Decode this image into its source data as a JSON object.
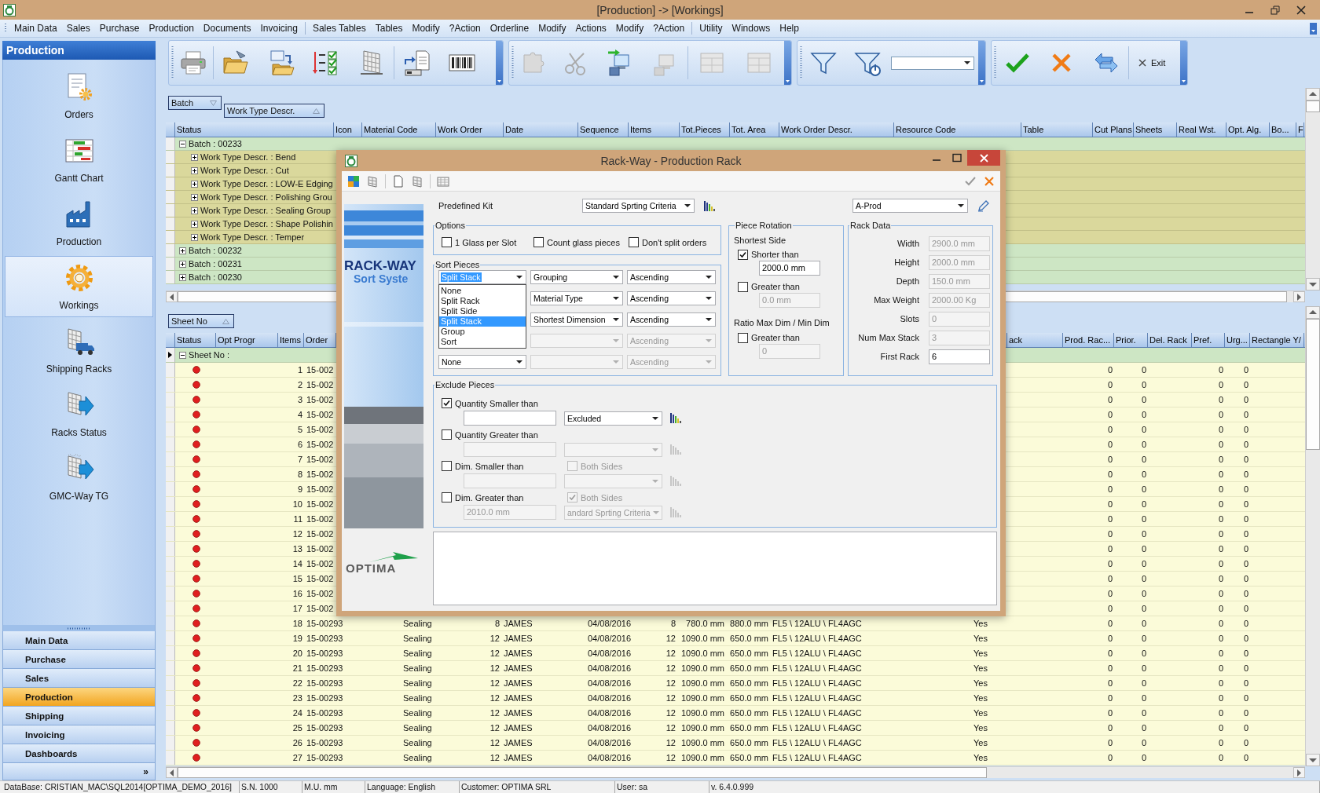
{
  "window": {
    "title": "[Production] -> [Workings]"
  },
  "menu": [
    [
      "Main Data",
      "Sales",
      "Purchase",
      "Production",
      "Documents",
      "Invoicing"
    ],
    [
      "Sales Tables",
      "Tables",
      "Modify",
      "?Action",
      "Orderline",
      "Modify",
      "Actions",
      "Modify",
      "?Action"
    ],
    [
      "Utility",
      "Windows",
      "Help"
    ]
  ],
  "sidebar": {
    "title": "Production",
    "items": [
      {
        "label": "Orders",
        "selected": false
      },
      {
        "label": "Gantt Chart",
        "selected": false
      },
      {
        "label": "Production",
        "selected": false
      },
      {
        "label": "Workings",
        "selected": true
      },
      {
        "label": "Shipping Racks",
        "selected": false
      },
      {
        "label": "Racks Status",
        "selected": false
      },
      {
        "label": "GMC-Way TG",
        "selected": false
      }
    ],
    "nav": [
      {
        "label": "Main Data",
        "selected": false
      },
      {
        "label": "Purchase",
        "selected": false
      },
      {
        "label": "Sales",
        "selected": false
      },
      {
        "label": "Production",
        "selected": true
      },
      {
        "label": "Shipping",
        "selected": false
      },
      {
        "label": "Invoicing",
        "selected": false
      },
      {
        "label": "Dashboards",
        "selected": false
      }
    ],
    "more": "»"
  },
  "toolbar": {
    "exit": "Exit"
  },
  "batch_grid": {
    "group_by": [
      {
        "label": "Batch",
        "descending": true
      },
      {
        "label": "Work Type Descr.",
        "descending": false
      }
    ],
    "columns": [
      "Status",
      "Icon",
      "Material Code",
      "Work Order",
      "Date",
      "Sequence",
      "Items",
      "Tot.Pieces",
      "Tot. Area",
      "Work Order Descr.",
      "Resource Code",
      "Table",
      "Cut Plans",
      "Sheets",
      "Real Wst.",
      "Opt. Alg.",
      "Bo...",
      "F"
    ],
    "rows": [
      {
        "label": "Batch : 00233",
        "expanded": true,
        "children": [
          {
            "label": "Work Type Descr. : Bend",
            "expanded": false
          },
          {
            "label": "Work Type Descr. : Cut",
            "expanded": false
          },
          {
            "label": "Work Type Descr. : LOW-E Edging",
            "expanded": false
          },
          {
            "label": "Work Type Descr. : Polishing Grou",
            "expanded": false
          },
          {
            "label": "Work Type Descr. : Sealing Group",
            "expanded": false
          },
          {
            "label": "Work Type Descr. : Shape Polishin",
            "expanded": false
          },
          {
            "label": "Work Type Descr. : Temper",
            "expanded": false
          }
        ]
      },
      {
        "label": "Batch : 00232",
        "expanded": false
      },
      {
        "label": "Batch : 00231",
        "expanded": false
      },
      {
        "label": "Batch : 00230",
        "expanded": false
      }
    ]
  },
  "sheet_grid": {
    "group_by": [
      {
        "label": "Sheet No",
        "descending": false
      }
    ],
    "columns_left": [
      "Status",
      "Opt Progr",
      "Items",
      "Order"
    ],
    "columns_right": [
      "ack",
      "Prod. Rac...",
      "Prior.",
      "Del. Rack",
      "Pref.",
      "Urg...",
      "Rectangle Y/"
    ],
    "group_row": {
      "label": "Sheet No :",
      "expanded": true,
      "current": true
    },
    "rows": [
      {
        "items": "1",
        "order": "15-002",
        "prod_rac": "0",
        "prior": "0",
        "pref": "0",
        "urg": "0"
      },
      {
        "items": "2",
        "order": "15-002",
        "prod_rac": "0",
        "prior": "0",
        "pref": "0",
        "urg": "0"
      },
      {
        "items": "3",
        "order": "15-002",
        "prod_rac": "0",
        "prior": "0",
        "pref": "0",
        "urg": "0"
      },
      {
        "items": "4",
        "order": "15-002",
        "prod_rac": "0",
        "prior": "0",
        "pref": "0",
        "urg": "0"
      },
      {
        "items": "5",
        "order": "15-002",
        "prod_rac": "0",
        "prior": "0",
        "pref": "0",
        "urg": "0"
      },
      {
        "items": "6",
        "order": "15-002",
        "prod_rac": "0",
        "prior": "0",
        "pref": "0",
        "urg": "0"
      },
      {
        "items": "7",
        "order": "15-002",
        "prod_rac": "0",
        "prior": "0",
        "pref": "0",
        "urg": "0"
      },
      {
        "items": "8",
        "order": "15-002",
        "prod_rac": "0",
        "prior": "0",
        "pref": "0",
        "urg": "0"
      },
      {
        "items": "9",
        "order": "15-002",
        "prod_rac": "0",
        "prior": "0",
        "pref": "0",
        "urg": "0"
      },
      {
        "items": "10",
        "order": "15-002",
        "prod_rac": "0",
        "prior": "0",
        "pref": "0",
        "urg": "0"
      },
      {
        "items": "11",
        "order": "15-002",
        "prod_rac": "0",
        "prior": "0",
        "pref": "0",
        "urg": "0"
      },
      {
        "items": "12",
        "order": "15-002",
        "prod_rac": "0",
        "prior": "0",
        "pref": "0",
        "urg": "0"
      },
      {
        "items": "13",
        "order": "15-002",
        "prod_rac": "0",
        "prior": "0",
        "pref": "0",
        "urg": "0"
      },
      {
        "items": "14",
        "order": "15-002",
        "prod_rac": "0",
        "prior": "0",
        "pref": "0",
        "urg": "0"
      },
      {
        "items": "15",
        "order": "15-002",
        "prod_rac": "0",
        "prior": "0",
        "pref": "0",
        "urg": "0"
      },
      {
        "items": "16",
        "order": "15-002",
        "prod_rac": "0",
        "prior": "0",
        "pref": "0",
        "urg": "0"
      },
      {
        "items": "17",
        "order": "15-002",
        "prod_rac": "0",
        "prior": "0",
        "pref": "0",
        "urg": "0"
      },
      {
        "items": "18",
        "order": "15-00293",
        "column_5": "Sealing",
        "column_6": "8",
        "column_7": "JAMES",
        "column_8": "04/08/2016",
        "column_9": "8",
        "column_10": "780.0 mm",
        "column_11": "880.0 mm",
        "column_12": "FL5 \\ 12ALU \\ FL4AGC",
        "column_13": "Yes",
        "prod_rac": "0",
        "prior": "0",
        "pref": "0",
        "urg": "0"
      },
      {
        "items": "19",
        "order": "15-00293",
        "column_5": "Sealing",
        "column_6": "12",
        "column_7": "JAMES",
        "column_8": "04/08/2016",
        "column_9": "12",
        "column_10": "1090.0 mm",
        "column_11": "650.0 mm",
        "column_12": "FL5 \\ 12ALU \\ FL4AGC",
        "column_13": "Yes",
        "prod_rac": "0",
        "prior": "0",
        "pref": "0",
        "urg": "0"
      },
      {
        "items": "20",
        "order": "15-00293",
        "column_5": "Sealing",
        "column_6": "12",
        "column_7": "JAMES",
        "column_8": "04/08/2016",
        "column_9": "12",
        "column_10": "1090.0 mm",
        "column_11": "650.0 mm",
        "column_12": "FL5 \\ 12ALU \\ FL4AGC",
        "column_13": "Yes",
        "prod_rac": "0",
        "prior": "0",
        "pref": "0",
        "urg": "0"
      },
      {
        "items": "21",
        "order": "15-00293",
        "column_5": "Sealing",
        "column_6": "12",
        "column_7": "JAMES",
        "column_8": "04/08/2016",
        "column_9": "12",
        "column_10": "1090.0 mm",
        "column_11": "650.0 mm",
        "column_12": "FL5 \\ 12ALU \\ FL4AGC",
        "column_13": "Yes",
        "prod_rac": "0",
        "prior": "0",
        "pref": "0",
        "urg": "0"
      },
      {
        "items": "22",
        "order": "15-00293",
        "column_5": "Sealing",
        "column_6": "12",
        "column_7": "JAMES",
        "column_8": "04/08/2016",
        "column_9": "12",
        "column_10": "1090.0 mm",
        "column_11": "650.0 mm",
        "column_12": "FL5 \\ 12ALU \\ FL4AGC",
        "column_13": "Yes",
        "prod_rac": "0",
        "prior": "0",
        "pref": "0",
        "urg": "0"
      },
      {
        "items": "23",
        "order": "15-00293",
        "column_5": "Sealing",
        "column_6": "12",
        "column_7": "JAMES",
        "column_8": "04/08/2016",
        "column_9": "12",
        "column_10": "1090.0 mm",
        "column_11": "650.0 mm",
        "column_12": "FL5 \\ 12ALU \\ FL4AGC",
        "column_13": "Yes",
        "prod_rac": "0",
        "prior": "0",
        "pref": "0",
        "urg": "0"
      },
      {
        "items": "24",
        "order": "15-00293",
        "column_5": "Sealing",
        "column_6": "12",
        "column_7": "JAMES",
        "column_8": "04/08/2016",
        "column_9": "12",
        "column_10": "1090.0 mm",
        "column_11": "650.0 mm",
        "column_12": "FL5 \\ 12ALU \\ FL4AGC",
        "column_13": "Yes",
        "prod_rac": "0",
        "prior": "0",
        "pref": "0",
        "urg": "0"
      },
      {
        "items": "25",
        "order": "15-00293",
        "column_5": "Sealing",
        "column_6": "12",
        "column_7": "JAMES",
        "column_8": "04/08/2016",
        "column_9": "12",
        "column_10": "1090.0 mm",
        "column_11": "650.0 mm",
        "column_12": "FL5 \\ 12ALU \\ FL4AGC",
        "column_13": "Yes",
        "prod_rac": "0",
        "prior": "0",
        "pref": "0",
        "urg": "0"
      },
      {
        "items": "26",
        "order": "15-00293",
        "column_5": "Sealing",
        "column_6": "12",
        "column_7": "JAMES",
        "column_8": "04/08/2016",
        "column_9": "12",
        "column_10": "1090.0 mm",
        "column_11": "650.0 mm",
        "column_12": "FL5 \\ 12ALU \\ FL4AGC",
        "column_13": "Yes",
        "prod_rac": "0",
        "prior": "0",
        "pref": "0",
        "urg": "0"
      },
      {
        "items": "27",
        "order": "15-00293",
        "column_5": "Sealing",
        "column_6": "12",
        "column_7": "JAMES",
        "column_8": "04/08/2016",
        "column_9": "12",
        "column_10": "1090.0 mm",
        "column_11": "650.0 mm",
        "column_12": "FL5 \\ 12ALU \\ FL4AGC",
        "column_13": "Yes",
        "prod_rac": "0",
        "prior": "0",
        "pref": "0",
        "urg": "0"
      }
    ]
  },
  "dialog": {
    "title": "Rack-Way - Production Rack",
    "banner": {
      "title": "RACK-WAY",
      "subtitle": "Sort Syste"
    },
    "logo": "OPTIMA",
    "predefined_kit": {
      "label": "Predefined Kit",
      "value": "Standard Sprting Criteria"
    },
    "profile": {
      "value": "A-Prod"
    },
    "options": {
      "title": "Options",
      "items": [
        {
          "label": "1 Glass per Slot",
          "checked": false
        },
        {
          "label": "Count glass pieces",
          "checked": false
        },
        {
          "label": "Don't split orders",
          "checked": false
        }
      ]
    },
    "sort_pieces": {
      "title": "Sort Pieces",
      "rows": [
        {
          "criterion": {
            "value": "Split Stack",
            "disabled": false,
            "focused": true
          },
          "field": {
            "value": "Grouping",
            "disabled": false
          },
          "order": {
            "value": "Ascending",
            "disabled": false
          }
        },
        {
          "field": {
            "value": "Material Type",
            "disabled": false
          },
          "order": {
            "value": "Ascending",
            "disabled": false
          }
        },
        {
          "field": {
            "value": "Shortest Dimension",
            "disabled": false
          },
          "order": {
            "value": "Ascending",
            "disabled": false
          }
        },
        {
          "field": {
            "disabled": true
          },
          "order": {
            "value": "Ascending",
            "disabled": true
          }
        },
        {
          "criterion": {
            "value": "None",
            "disabled": false,
            "focused": false
          },
          "field": {
            "disabled": true
          },
          "order": {
            "value": "Ascending",
            "disabled": true
          }
        }
      ],
      "list": {
        "items": [
          {
            "label": "None",
            "selected": false
          },
          {
            "label": "Split Rack",
            "selected": false
          },
          {
            "label": "Split Side",
            "selected": false
          },
          {
            "label": "Split Stack",
            "selected": true
          },
          {
            "label": "Group",
            "selected": false
          },
          {
            "label": "Sort",
            "selected": false
          }
        ]
      }
    },
    "piece_rotation": {
      "title": "Piece Rotation",
      "shortest_side": "Shortest Side",
      "shorter_than": {
        "label": "Shorter than",
        "checked": true,
        "value": "2000.0 mm"
      },
      "greater_than": {
        "label": "Greater than",
        "checked": false,
        "value": "0.0 mm"
      },
      "ratio_title": "Ratio Max Dim / Min Dim",
      "ratio_greater_than": {
        "label": "Greater than",
        "checked": false,
        "value": "0"
      }
    },
    "rack_data": {
      "title": "Rack Data",
      "fields": [
        {
          "label": "Width",
          "value": "2900.0 mm",
          "disabled": true
        },
        {
          "label": "Height",
          "value": "2000.0 mm",
          "disabled": true
        },
        {
          "label": "Depth",
          "value": "150.0 mm",
          "disabled": true
        },
        {
          "label": "Max Weight",
          "value": "2000.00 Kg",
          "disabled": true
        },
        {
          "label": "Slots",
          "value": "0",
          "disabled": true
        },
        {
          "label": "Num Max Stack",
          "value": "3",
          "disabled": true
        },
        {
          "label": "First Rack",
          "value": "6",
          "disabled": false
        }
      ]
    },
    "exclude_pieces": {
      "title": "Exclude Pieces",
      "rules": [
        {
          "label": "Quantity Smaller than",
          "checked": true,
          "action": "Excluded"
        },
        {
          "label": "Quantity Greater than",
          "checked": false
        },
        {
          "label": "Dim. Smaller than",
          "checked": false,
          "both_sides": {
            "label": "Both Sides",
            "checked": false
          }
        },
        {
          "label": "Dim. Greater than",
          "checked": false,
          "both_sides": {
            "label": "Both Sides",
            "checked": true
          },
          "value": "2010.0 mm",
          "action": "andard Sprting Criteria"
        }
      ]
    }
  },
  "status_bar": [
    "DataBase: CRISTIAN_MAC\\SQL2014[OPTIMA_DEMO_2016]",
    "S.N. 1000",
    "M.U. mm",
    "Language: English",
    "Customer: OPTIMA SRL",
    "User: sa",
    "v. 6.4.0.999"
  ]
}
